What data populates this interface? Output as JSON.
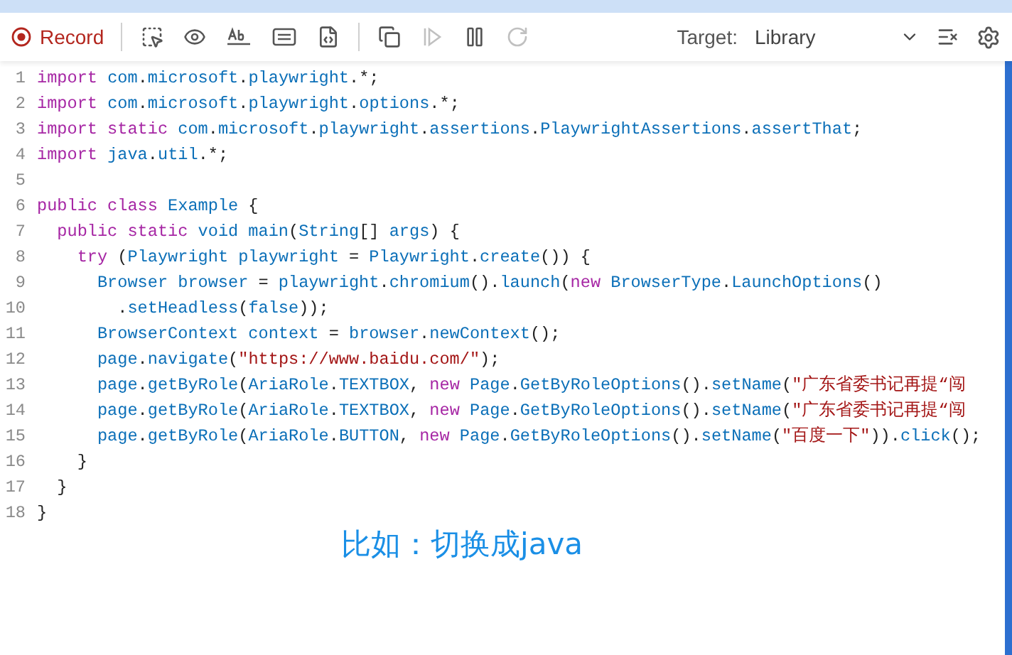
{
  "toolbar": {
    "record": {
      "label": "Record",
      "on": true
    },
    "tool_groups": [
      [
        {
          "kind": "pick",
          "disabled": false
        },
        {
          "kind": "eye",
          "disabled": false
        },
        {
          "kind": "text",
          "disabled": false
        },
        {
          "kind": "list",
          "disabled": false
        },
        {
          "kind": "code",
          "disabled": false
        }
      ],
      [
        {
          "kind": "copy",
          "disabled": false
        },
        {
          "kind": "resume",
          "disabled": true
        },
        {
          "kind": "pause",
          "disabled": false
        },
        {
          "kind": "step",
          "disabled": true
        }
      ]
    ],
    "target_label": "Target:",
    "target_value": "Library"
  },
  "code": {
    "lines": [
      {
        "number": "1",
        "tokens": [
          {
            "kind": "k",
            "text": "import "
          },
          {
            "kind": "i",
            "text": "com"
          },
          {
            "kind": "p",
            "text": "."
          },
          {
            "kind": "i",
            "text": "microsoft"
          },
          {
            "kind": "p",
            "text": "."
          },
          {
            "kind": "i",
            "text": "playwright"
          },
          {
            "kind": "p",
            "text": ".*;"
          }
        ]
      },
      {
        "number": "2",
        "tokens": [
          {
            "kind": "k",
            "text": "import "
          },
          {
            "kind": "i",
            "text": "com"
          },
          {
            "kind": "p",
            "text": "."
          },
          {
            "kind": "i",
            "text": "microsoft"
          },
          {
            "kind": "p",
            "text": "."
          },
          {
            "kind": "i",
            "text": "playwright"
          },
          {
            "kind": "p",
            "text": "."
          },
          {
            "kind": "i",
            "text": "options"
          },
          {
            "kind": "p",
            "text": ".*;"
          }
        ]
      },
      {
        "number": "3",
        "tokens": [
          {
            "kind": "k",
            "text": "import static "
          },
          {
            "kind": "i",
            "text": "com"
          },
          {
            "kind": "p",
            "text": "."
          },
          {
            "kind": "i",
            "text": "microsoft"
          },
          {
            "kind": "p",
            "text": "."
          },
          {
            "kind": "i",
            "text": "playwright"
          },
          {
            "kind": "p",
            "text": "."
          },
          {
            "kind": "i",
            "text": "assertions"
          },
          {
            "kind": "p",
            "text": "."
          },
          {
            "kind": "i",
            "text": "PlaywrightAssertions"
          },
          {
            "kind": "p",
            "text": "."
          },
          {
            "kind": "i",
            "text": "assertThat"
          },
          {
            "kind": "p",
            "text": ";"
          }
        ]
      },
      {
        "number": "4",
        "tokens": [
          {
            "kind": "k",
            "text": "import "
          },
          {
            "kind": "i",
            "text": "java"
          },
          {
            "kind": "p",
            "text": "."
          },
          {
            "kind": "i",
            "text": "util"
          },
          {
            "kind": "p",
            "text": ".*;"
          }
        ]
      },
      {
        "number": "5"
      },
      {
        "number": "6",
        "tokens": [
          {
            "kind": "k",
            "text": "public class "
          },
          {
            "kind": "i",
            "text": "Example"
          },
          {
            "kind": "p",
            "text": " {"
          }
        ]
      },
      {
        "number": "7",
        "tokens": [
          {
            "kind": "k",
            "text": "  public static "
          },
          {
            "kind": "i",
            "text": "void main"
          },
          {
            "kind": "p",
            "text": "("
          },
          {
            "kind": "i",
            "text": "String"
          },
          {
            "kind": "p",
            "text": "[] "
          },
          {
            "kind": "i",
            "text": "args"
          },
          {
            "kind": "p",
            "text": ") {"
          }
        ]
      },
      {
        "number": "8",
        "tokens": [
          {
            "kind": "k",
            "text": "    try"
          },
          {
            "kind": "p",
            "text": " ("
          },
          {
            "kind": "i",
            "text": "Playwright playwright"
          },
          {
            "kind": "p",
            "text": " = "
          },
          {
            "kind": "i",
            "text": "Playwright"
          },
          {
            "kind": "p",
            "text": "."
          },
          {
            "kind": "i",
            "text": "create"
          },
          {
            "kind": "p",
            "text": "()) {"
          }
        ]
      },
      {
        "number": "9",
        "tokens": [
          {
            "kind": "i",
            "text": "      Browser browser"
          },
          {
            "kind": "p",
            "text": " = "
          },
          {
            "kind": "i",
            "text": "playwright"
          },
          {
            "kind": "p",
            "text": "."
          },
          {
            "kind": "i",
            "text": "chromium"
          },
          {
            "kind": "p",
            "text": "()."
          },
          {
            "kind": "i",
            "text": "launch"
          },
          {
            "kind": "p",
            "text": "("
          },
          {
            "kind": "k",
            "text": "new "
          },
          {
            "kind": "i",
            "text": "BrowserType"
          },
          {
            "kind": "p",
            "text": "."
          },
          {
            "kind": "i",
            "text": "LaunchOptions"
          },
          {
            "kind": "p",
            "text": "()"
          }
        ]
      },
      {
        "number": "10",
        "tokens": [
          {
            "kind": "p",
            "text": "        ."
          },
          {
            "kind": "i",
            "text": "setHeadless"
          },
          {
            "kind": "p",
            "text": "("
          },
          {
            "kind": "i",
            "text": "false"
          },
          {
            "kind": "p",
            "text": "));"
          }
        ]
      },
      {
        "number": "11",
        "tokens": [
          {
            "kind": "i",
            "text": "      BrowserContext context"
          },
          {
            "kind": "p",
            "text": " = "
          },
          {
            "kind": "i",
            "text": "browser"
          },
          {
            "kind": "p",
            "text": "."
          },
          {
            "kind": "i",
            "text": "newContext"
          },
          {
            "kind": "p",
            "text": "();"
          }
        ]
      },
      {
        "number": "12",
        "tokens": [
          {
            "kind": "i",
            "text": "      page"
          },
          {
            "kind": "p",
            "text": "."
          },
          {
            "kind": "i",
            "text": "navigate"
          },
          {
            "kind": "p",
            "text": "("
          },
          {
            "kind": "s",
            "text": "\"https://www.baidu.com/\""
          },
          {
            "kind": "p",
            "text": ");"
          }
        ]
      },
      {
        "number": "13",
        "tokens": [
          {
            "kind": "i",
            "text": "      page"
          },
          {
            "kind": "p",
            "text": "."
          },
          {
            "kind": "i",
            "text": "getByRole"
          },
          {
            "kind": "p",
            "text": "("
          },
          {
            "kind": "i",
            "text": "AriaRole"
          },
          {
            "kind": "p",
            "text": "."
          },
          {
            "kind": "i",
            "text": "TEXTBOX"
          },
          {
            "kind": "p",
            "text": ", "
          },
          {
            "kind": "k",
            "text": "new "
          },
          {
            "kind": "i",
            "text": "Page"
          },
          {
            "kind": "p",
            "text": "."
          },
          {
            "kind": "i",
            "text": "GetByRoleOptions"
          },
          {
            "kind": "p",
            "text": "()."
          },
          {
            "kind": "i",
            "text": "setName"
          },
          {
            "kind": "p",
            "text": "("
          },
          {
            "kind": "s",
            "text": "\"广东省委书记再提“闯"
          }
        ]
      },
      {
        "number": "14",
        "tokens": [
          {
            "kind": "i",
            "text": "      page"
          },
          {
            "kind": "p",
            "text": "."
          },
          {
            "kind": "i",
            "text": "getByRole"
          },
          {
            "kind": "p",
            "text": "("
          },
          {
            "kind": "i",
            "text": "AriaRole"
          },
          {
            "kind": "p",
            "text": "."
          },
          {
            "kind": "i",
            "text": "TEXTBOX"
          },
          {
            "kind": "p",
            "text": ", "
          },
          {
            "kind": "k",
            "text": "new "
          },
          {
            "kind": "i",
            "text": "Page"
          },
          {
            "kind": "p",
            "text": "."
          },
          {
            "kind": "i",
            "text": "GetByRoleOptions"
          },
          {
            "kind": "p",
            "text": "()."
          },
          {
            "kind": "i",
            "text": "setName"
          },
          {
            "kind": "p",
            "text": "("
          },
          {
            "kind": "s",
            "text": "\"广东省委书记再提“闯"
          }
        ]
      },
      {
        "number": "15",
        "tokens": [
          {
            "kind": "i",
            "text": "      page"
          },
          {
            "kind": "p",
            "text": "."
          },
          {
            "kind": "i",
            "text": "getByRole"
          },
          {
            "kind": "p",
            "text": "("
          },
          {
            "kind": "i",
            "text": "AriaRole"
          },
          {
            "kind": "p",
            "text": "."
          },
          {
            "kind": "i",
            "text": "BUTTON"
          },
          {
            "kind": "p",
            "text": ", "
          },
          {
            "kind": "k",
            "text": "new "
          },
          {
            "kind": "i",
            "text": "Page"
          },
          {
            "kind": "p",
            "text": "."
          },
          {
            "kind": "i",
            "text": "GetByRoleOptions"
          },
          {
            "kind": "p",
            "text": "()."
          },
          {
            "kind": "i",
            "text": "setName"
          },
          {
            "kind": "p",
            "text": "("
          },
          {
            "kind": "s",
            "text": "\"百度一下\""
          },
          {
            "kind": "p",
            "text": "))."
          },
          {
            "kind": "i",
            "text": "click"
          },
          {
            "kind": "p",
            "text": "();"
          }
        ]
      },
      {
        "number": "16",
        "tokens": [
          {
            "kind": "p",
            "text": "    }"
          }
        ]
      },
      {
        "number": "17",
        "tokens": [
          {
            "kind": "p",
            "text": "  }"
          }
        ]
      },
      {
        "number": "18",
        "tokens": [
          {
            "kind": "p",
            "text": "}"
          }
        ]
      }
    ]
  },
  "caption": "比如：切换成java"
}
